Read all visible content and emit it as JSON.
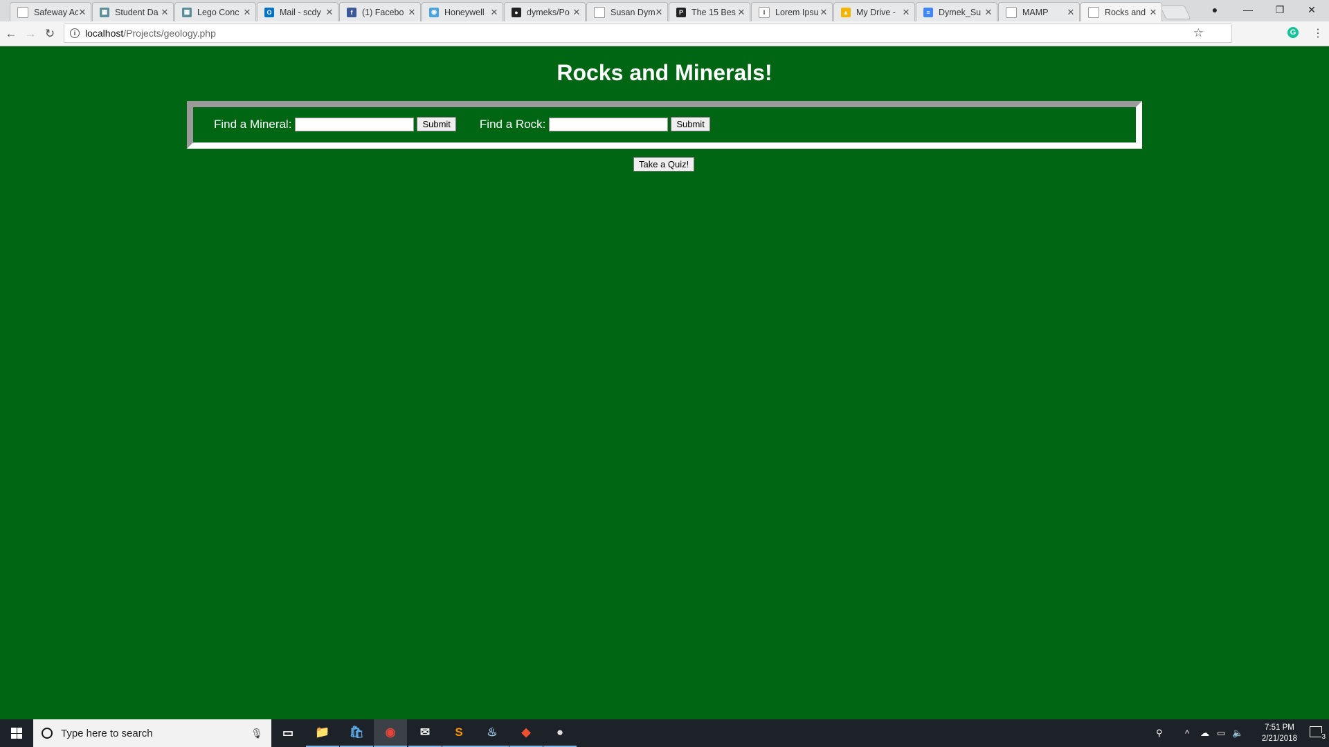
{
  "browser": {
    "tabs": [
      {
        "title": "Safeway Ac",
        "favicon": "blank-page-icon",
        "color": "#ffffff",
        "glyph": ""
      },
      {
        "title": "Student Da",
        "favicon": "site-icon",
        "color": "#5a8f9a",
        "glyph": "▦"
      },
      {
        "title": "Lego Conc",
        "favicon": "site-icon",
        "color": "#5a8f9a",
        "glyph": "▦"
      },
      {
        "title": "Mail - scdy",
        "favicon": "outlook-icon",
        "color": "#0072c6",
        "glyph": "O"
      },
      {
        "title": "(1) Facebo",
        "favicon": "facebook-icon",
        "color": "#3b5998",
        "glyph": "f"
      },
      {
        "title": "Honeywell",
        "favicon": "honeywell-icon",
        "color": "#4aa3df",
        "glyph": "◉"
      },
      {
        "title": "dymeks/Po",
        "favicon": "github-icon",
        "color": "#222222",
        "glyph": "●"
      },
      {
        "title": "Susan Dym",
        "favicon": "page-icon",
        "color": "#ffffff",
        "glyph": ""
      },
      {
        "title": "The 15 Bes",
        "favicon": "p-icon",
        "color": "#222222",
        "glyph": "P"
      },
      {
        "title": "Lorem Ipsu",
        "favicon": "l-icon",
        "color": "#ffffff",
        "glyph": "I"
      },
      {
        "title": "My Drive -",
        "favicon": "drive-icon",
        "color": "#f4b400",
        "glyph": "▲"
      },
      {
        "title": "Dymek_Su",
        "favicon": "docs-icon",
        "color": "#4285f4",
        "glyph": "≡"
      },
      {
        "title": "MAMP",
        "favicon": "page-icon",
        "color": "#ffffff",
        "glyph": ""
      },
      {
        "title": "Rocks and",
        "favicon": "page-icon",
        "color": "#ffffff",
        "glyph": "",
        "active": true
      }
    ],
    "close_glyph": "✕",
    "window_controls": {
      "profile": "●",
      "minimize": "—",
      "maximize": "❐",
      "close": "✕"
    },
    "nav": {
      "back": "←",
      "forward": "→",
      "reload": "↻"
    },
    "address": {
      "info": "i",
      "host": "localhost",
      "path": "/Projects/geology.php"
    },
    "star": "☆",
    "grammarly": "G",
    "menu": "⋮"
  },
  "page": {
    "title": "Rocks and Minerals!",
    "mineral": {
      "label": "Find a Mineral:",
      "value": "",
      "submit": "Submit"
    },
    "rock": {
      "label": "Find a Rock:",
      "value": "",
      "submit": "Submit"
    },
    "quiz_button": "Take a Quiz!",
    "background_color": "#006614"
  },
  "taskbar": {
    "search_placeholder": "Type here to search",
    "mic": "🎙",
    "apps": [
      {
        "name": "task-view-icon",
        "glyph": "▭"
      },
      {
        "name": "file-explorer-icon",
        "glyph": "📁"
      },
      {
        "name": "store-icon",
        "glyph": "🛍"
      },
      {
        "name": "chrome-icon",
        "glyph": "◉"
      },
      {
        "name": "mail-icon",
        "glyph": "✉"
      },
      {
        "name": "sublime-text-icon",
        "glyph": "S"
      },
      {
        "name": "steam-icon",
        "glyph": "♨"
      },
      {
        "name": "git-icon",
        "glyph": "◆"
      },
      {
        "name": "github-desktop-icon",
        "glyph": "●"
      }
    ],
    "tray": {
      "people": "⚲",
      "chevron": "^",
      "onedrive": "☁",
      "network": "▭",
      "volume": "🔈"
    },
    "time": "7:51 PM",
    "date": "2/21/2018",
    "notifications": "3"
  }
}
